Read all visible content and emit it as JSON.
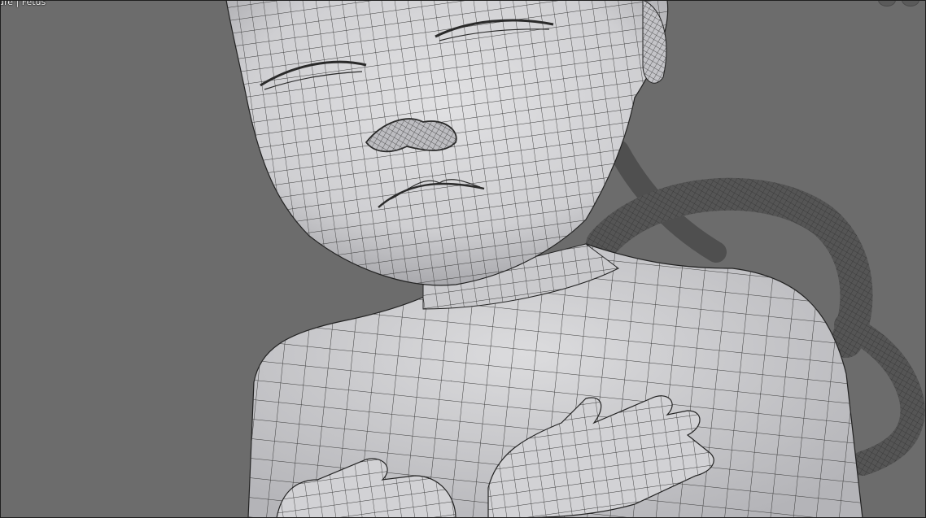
{
  "viewport": {
    "header_text": "ure | Fetus",
    "background_color": "#6c6c6c",
    "mesh_fill_color": "#cfcfd2",
    "wire_color": "#2b2b2b"
  },
  "gizmos": [
    {
      "name": "viewport-nav-gizmo-left-icon"
    },
    {
      "name": "viewport-nav-gizmo-right-icon"
    }
  ]
}
